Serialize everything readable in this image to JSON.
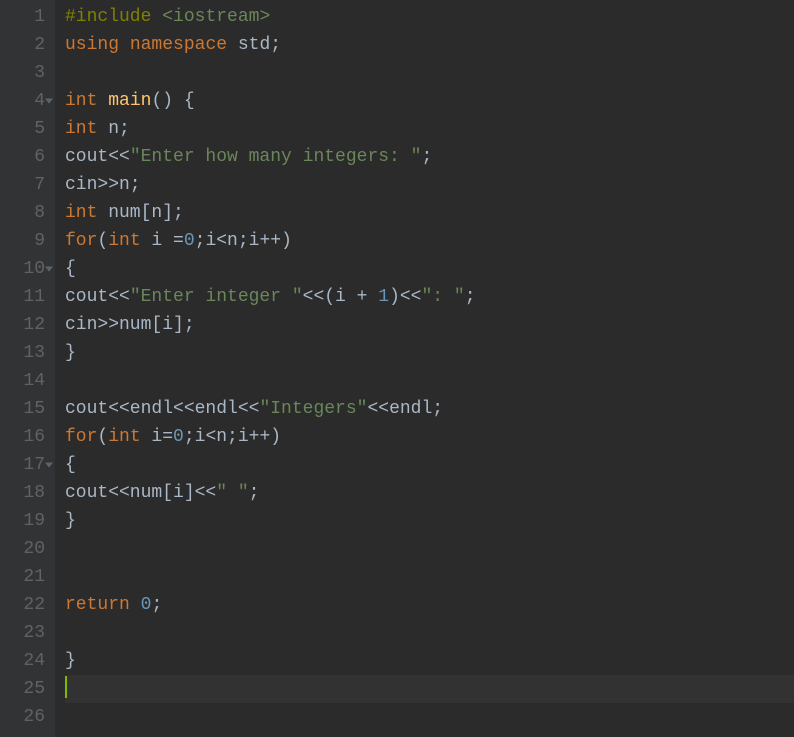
{
  "gutter": {
    "numbers": [
      "1",
      "2",
      "3",
      "4",
      "5",
      "6",
      "7",
      "8",
      "9",
      "10",
      "11",
      "12",
      "13",
      "14",
      "15",
      "16",
      "17",
      "18",
      "19",
      "20",
      "21",
      "22",
      "23",
      "24",
      "25",
      "26"
    ],
    "foldLines": [
      4,
      10,
      17
    ],
    "activeLine": 25
  },
  "code": {
    "l1": {
      "t1": "#include",
      "t2": " ",
      "t3": "<iostream>"
    },
    "l2": {
      "t1": "using",
      "t2": " ",
      "t3": "namespace",
      "t4": " std;"
    },
    "l3": "",
    "l4": {
      "t1": "int",
      "t2": " ",
      "t3": "main",
      "t4": "() {"
    },
    "l5": {
      "t1": "int",
      "t2": " n;"
    },
    "l6": {
      "t1": "cout<<",
      "t2": "\"Enter how many integers: \"",
      "t3": ";"
    },
    "l7": "cin>>n;",
    "l8": {
      "t1": "int",
      "t2": " num[n];"
    },
    "l9": {
      "t1": "for",
      "t2": "(",
      "t3": "int",
      "t4": " i =",
      "t5": "0",
      "t6": ";i<n;i++)"
    },
    "l10": "{",
    "l11": {
      "t1": "cout<<",
      "t2": "\"Enter integer \"",
      "t3": "<<(i + ",
      "t4": "1",
      "t5": ")<<",
      "t6": "\": \"",
      "t7": ";"
    },
    "l12": "cin>>num[i];",
    "l13": "}",
    "l14": "",
    "l15": {
      "t1": "cout<<endl<<endl<<",
      "t2": "\"Integers\"",
      "t3": "<<endl;"
    },
    "l16": {
      "t1": "for",
      "t2": "(",
      "t3": "int",
      "t4": " i=",
      "t5": "0",
      "t6": ";i<n;i++)"
    },
    "l17": "{",
    "l18": {
      "t1": "cout<<num[i]<<",
      "t2": "\" \"",
      "t3": ";"
    },
    "l19": "}",
    "l20": "",
    "l21": "",
    "l22": {
      "t1": "return",
      "t2": " ",
      "t3": "0",
      "t4": ";"
    },
    "l23": "",
    "l24": "}",
    "l25": "",
    "l26": ""
  }
}
